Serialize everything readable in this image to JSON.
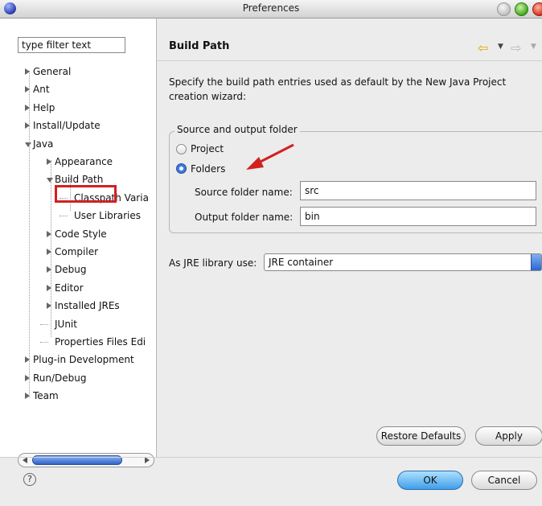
{
  "window": {
    "title": "Preferences"
  },
  "filter": {
    "value": "type filter text"
  },
  "tree": {
    "items": [
      {
        "label": "General",
        "level": 0,
        "state": "collapsed"
      },
      {
        "label": "Ant",
        "level": 0,
        "state": "collapsed"
      },
      {
        "label": "Help",
        "level": 0,
        "state": "collapsed"
      },
      {
        "label": "Install/Update",
        "level": 0,
        "state": "collapsed"
      },
      {
        "label": "Java",
        "level": 0,
        "state": "expanded"
      },
      {
        "label": "Appearance",
        "level": 1,
        "state": "collapsed"
      },
      {
        "label": "Build Path",
        "level": 1,
        "state": "expanded",
        "selected": true
      },
      {
        "label": "Classpath Varia",
        "level": 2,
        "state": "leaf"
      },
      {
        "label": "User Libraries",
        "level": 2,
        "state": "leaf"
      },
      {
        "label": "Code Style",
        "level": 1,
        "state": "collapsed"
      },
      {
        "label": "Compiler",
        "level": 1,
        "state": "collapsed"
      },
      {
        "label": "Debug",
        "level": 1,
        "state": "collapsed"
      },
      {
        "label": "Editor",
        "level": 1,
        "state": "collapsed"
      },
      {
        "label": "Installed JREs",
        "level": 1,
        "state": "collapsed"
      },
      {
        "label": "JUnit",
        "level": 1,
        "state": "leaf"
      },
      {
        "label": "Properties Files Edi",
        "level": 1,
        "state": "leaf"
      },
      {
        "label": "Plug-in Development",
        "level": 0,
        "state": "collapsed"
      },
      {
        "label": "Run/Debug",
        "level": 0,
        "state": "collapsed"
      },
      {
        "label": "Team",
        "level": 0,
        "state": "collapsed"
      }
    ]
  },
  "page": {
    "title": "Build Path",
    "description": "Specify the build path entries used as default by the New Java Project creation wizard:",
    "group_title": "Source and output folder",
    "radio_project": "Project",
    "radio_folders": "Folders",
    "selected_radio": "Folders",
    "source_label": "Source folder name:",
    "source_value": "src",
    "output_label": "Output folder name:",
    "output_value": "bin",
    "jre_label": "As JRE library use:",
    "jre_value": "JRE container",
    "restore_defaults": "Restore Defaults",
    "apply": "Apply"
  },
  "footer": {
    "ok": "OK",
    "cancel": "Cancel",
    "help": "?"
  },
  "icons": {
    "back": "back-arrow-icon",
    "forward": "forward-arrow-icon",
    "help": "help-icon"
  },
  "colors": {
    "highlight": "#d32020",
    "selection_blue": "#3d78dc"
  }
}
